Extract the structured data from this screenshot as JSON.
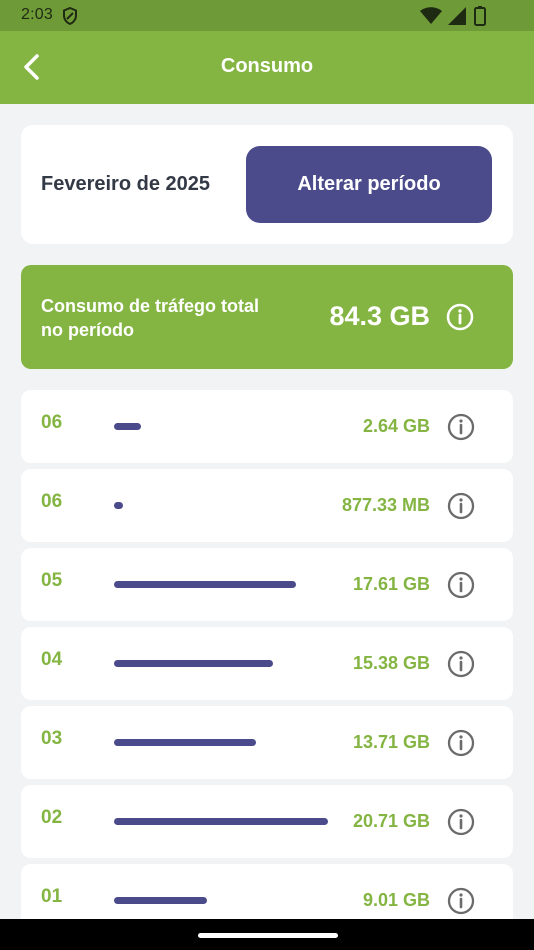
{
  "status_bar": {
    "time": "2:03"
  },
  "app_bar": {
    "title": "Consumo"
  },
  "period": {
    "label": "Fevereiro de 2025",
    "button_label": "Alterar período"
  },
  "total": {
    "label": "Consumo de tráfego total no período",
    "value": "84.3 GB"
  },
  "colors": {
    "green": "#84b543",
    "dark_green": "#6e9b37",
    "purple": "#4b4b8c"
  },
  "rows": [
    {
      "day": "06",
      "value": "2.64 GB",
      "bar_fraction": 0.128
    },
    {
      "day": "06",
      "value": "877.33 MB",
      "bar_fraction": 0.042
    },
    {
      "day": "05",
      "value": "17.61 GB",
      "bar_fraction": 0.85
    },
    {
      "day": "04",
      "value": "15.38 GB",
      "bar_fraction": 0.743
    },
    {
      "day": "03",
      "value": "13.71 GB",
      "bar_fraction": 0.662
    },
    {
      "day": "02",
      "value": "20.71 GB",
      "bar_fraction": 1.0
    },
    {
      "day": "01",
      "value": "9.01 GB",
      "bar_fraction": 0.435
    }
  ]
}
